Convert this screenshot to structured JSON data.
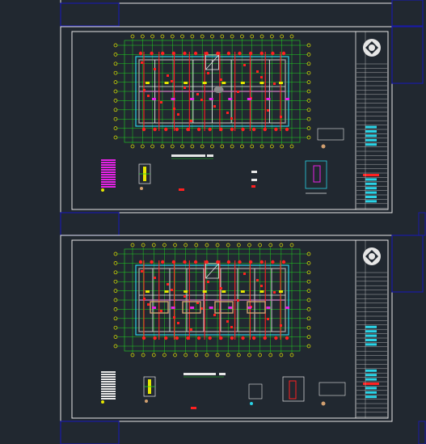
{
  "viewport": {
    "background": "#212830",
    "sheet_border_color": "#e6e6e6",
    "selection_color": "#1a1aa6"
  },
  "sheets": [
    {
      "id": "sheet-partial-top",
      "visible_portion": "bottom-edge-only"
    },
    {
      "id": "sheet-1",
      "plan": "floor-plan-drawing",
      "grid_labels_visible": true,
      "title_block_icon": "company-logo-icon"
    },
    {
      "id": "sheet-2",
      "plan": "floor-plan-drawing",
      "grid_labels_visible": true,
      "title_block_icon": "company-logo-icon"
    }
  ],
  "icons": [
    "company-logo-icon",
    "detail-section-icon",
    "column-schedule-icon"
  ]
}
